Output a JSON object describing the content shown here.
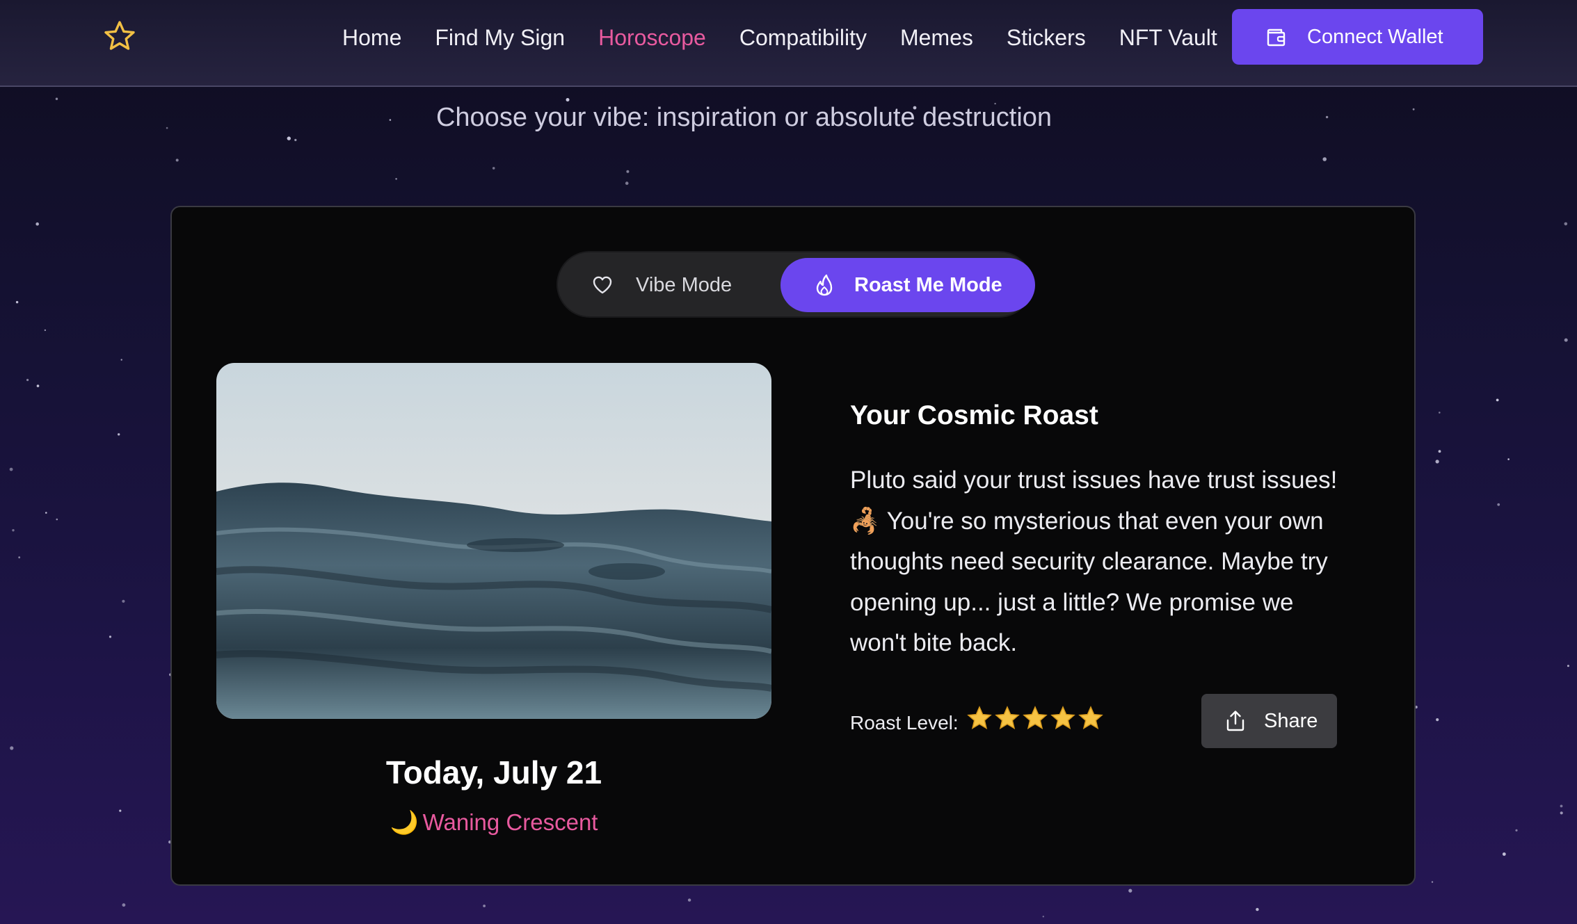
{
  "nav": {
    "logo_icon": "star-outline-icon",
    "links": [
      {
        "label": "Home",
        "active": false
      },
      {
        "label": "Find My Sign",
        "active": false
      },
      {
        "label": "Horoscope",
        "active": true
      },
      {
        "label": "Compatibility",
        "active": false
      },
      {
        "label": "Memes",
        "active": false
      },
      {
        "label": "Stickers",
        "active": false
      },
      {
        "label": "NFT Vault",
        "active": false
      }
    ],
    "wallet_button": {
      "label": "Connect Wallet",
      "icon": "wallet-icon"
    }
  },
  "subtitle": "Choose your vibe: inspiration or absolute destruction",
  "mode_toggle": {
    "options": [
      {
        "label": "Vibe Mode",
        "icon": "heart-icon",
        "selected": false
      },
      {
        "label": "Roast Me Mode",
        "icon": "flame-icon",
        "selected": true
      }
    ]
  },
  "reading": {
    "image_alt": "ocean waves at dusk",
    "date": "Today, July 21",
    "moon_icon": "🌙",
    "moon_phase": "Waning Crescent",
    "title": "Your Cosmic Roast",
    "text": "Pluto said your trust issues have trust issues! 🦂 You're so mysterious that even your own thoughts need security clearance. Maybe try opening up... just a little? We promise we won't bite back.",
    "roast_level_label": "Roast Level:",
    "roast_level": 5,
    "roast_level_max": 5,
    "share_label": "Share"
  },
  "colors": {
    "accent": "#6b46ee",
    "active_link": "#e85a9f",
    "star": "#f6c344"
  }
}
